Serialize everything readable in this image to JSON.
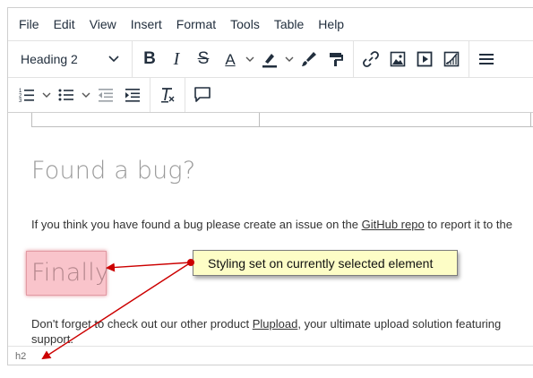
{
  "menubar": {
    "items": [
      "File",
      "Edit",
      "View",
      "Insert",
      "Format",
      "Tools",
      "Table",
      "Help"
    ]
  },
  "toolbar": {
    "block_format": "Heading 2",
    "icons": [
      "bold-icon",
      "italic-icon",
      "strikethrough-icon",
      "text-color-icon",
      "highlight-icon",
      "brush-icon",
      "format-painter-icon",
      "link-icon",
      "image-icon",
      "media-icon",
      "chart-icon",
      "align-icon"
    ],
    "icons_row2": [
      "numbered-list-icon",
      "bullet-list-icon",
      "outdent-icon",
      "indent-icon",
      "clear-formatting-icon",
      "comment-icon"
    ],
    "bold_glyph": "B",
    "italic_glyph": "I",
    "strike_glyph": "S",
    "text_color_glyph": "A",
    "text_color": "#222f3e",
    "highlight_color": "#222f3e"
  },
  "content": {
    "heading1": "Found a bug?",
    "paragraph1_before": "If you think you have found a bug please create an issue on the ",
    "paragraph1_link": "GitHub repo",
    "paragraph1_after": " to report it to the",
    "heading2": "Finally",
    "paragraph2_before": "Don't forget to check out our other product ",
    "paragraph2_link": "Plupload",
    "paragraph2_after": ", your ultimate upload solution featuring",
    "paragraph2_line2": "support."
  },
  "statusbar": {
    "path": "h2"
  },
  "annotation": {
    "callout_text": "Styling set on currently selected element",
    "arrow_color": "#cc0000",
    "callout_bg": "#fdfdc6",
    "selection_bg": "#f9c4cb"
  }
}
